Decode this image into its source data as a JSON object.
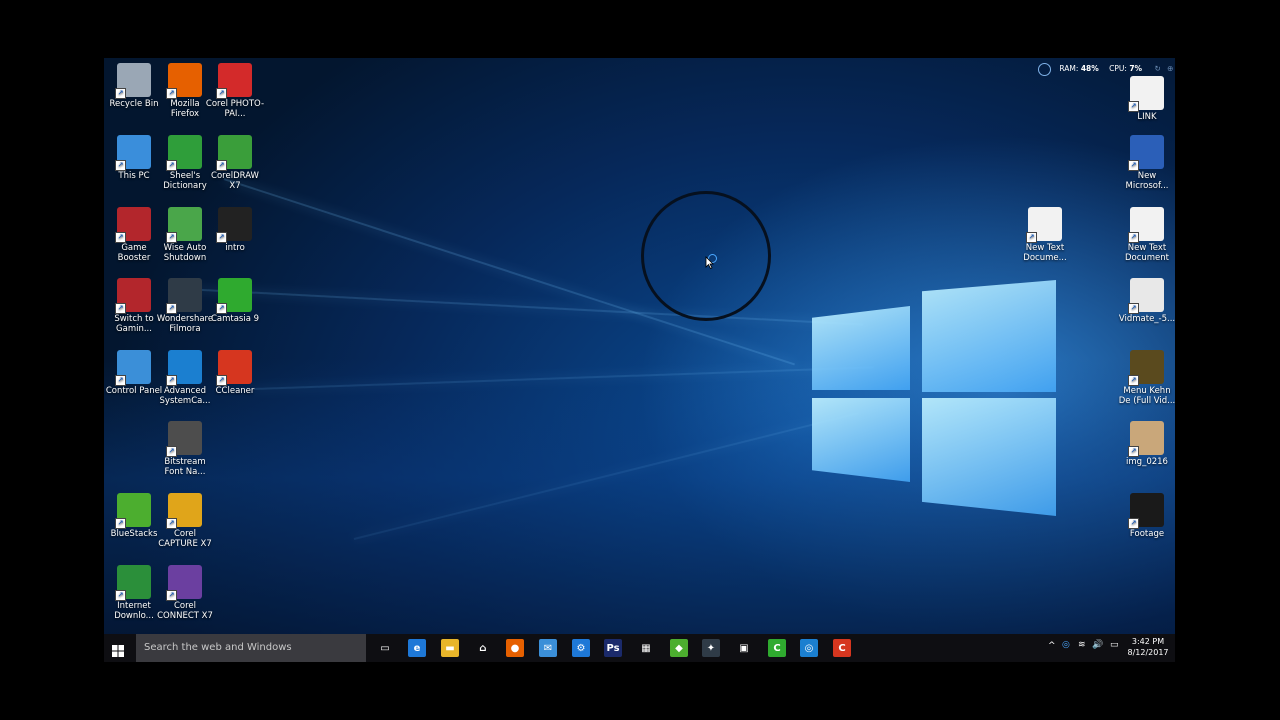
{
  "desktop": {
    "left_icons": [
      {
        "label": "Recycle Bin",
        "icon": "recycle-bin-icon",
        "color": "#9aa7b5"
      },
      {
        "label": "Mozilla Firefox",
        "icon": "firefox-icon",
        "color": "#e66000"
      },
      {
        "label": "Corel PHOTO-PAI...",
        "icon": "corel-photo-paint-icon",
        "color": "#d32a2a"
      },
      {
        "label": "This PC",
        "icon": "this-pc-icon",
        "color": "#3a8edb"
      },
      {
        "label": "Sheel's Dictionary",
        "icon": "sheels-dictionary-icon",
        "color": "#2f9e3a"
      },
      {
        "label": "CorelDRAW X7",
        "icon": "coreldraw-icon",
        "color": "#3a9e3a"
      },
      {
        "label": "Game Booster",
        "icon": "game-booster-icon",
        "color": "#b3262c"
      },
      {
        "label": "Wise Auto Shutdown",
        "icon": "wise-auto-shutdown-icon",
        "color": "#4aa64a"
      },
      {
        "label": "intro",
        "icon": "video-file-icon",
        "color": "#222222"
      },
      {
        "label": "Switch to Gamin...",
        "icon": "game-mode-icon",
        "color": "#b3262c"
      },
      {
        "label": "Wondershare Filmora",
        "icon": "filmora-icon",
        "color": "#2f3b47"
      },
      {
        "label": "Camtasia 9",
        "icon": "camtasia-icon",
        "color": "#2faa2f"
      },
      {
        "label": "Control Panel",
        "icon": "control-panel-icon",
        "color": "#3b8fd8"
      },
      {
        "label": "Advanced SystemCa...",
        "icon": "advanced-systemcare-icon",
        "color": "#1b7fd0"
      },
      {
        "label": "CCleaner",
        "icon": "ccleaner-icon",
        "color": "#d6361f"
      },
      {
        "label": "Bitstream Font Na...",
        "icon": "bitstream-font-icon",
        "color": "#4d4d4d"
      },
      {
        "label": "BlueStacks",
        "icon": "bluestacks-icon",
        "color": "#4cae2f"
      },
      {
        "label": "Corel CAPTURE X7",
        "icon": "corel-capture-icon",
        "color": "#e0a51a"
      },
      {
        "label": "Internet Downlo...",
        "icon": "internet-download-manager-icon",
        "color": "#2b8f3a"
      },
      {
        "label": "Corel CONNECT X7",
        "icon": "corel-connect-icon",
        "color": "#6b3fa0"
      }
    ],
    "right_icons": [
      {
        "label": "LINK",
        "icon": "text-file-icon",
        "color": "#f2f2f2"
      },
      {
        "label": "New Microsof...",
        "icon": "word-document-icon",
        "color": "#2b5fb8"
      },
      {
        "label": "New Text Docume...",
        "icon": "text-file-icon",
        "color": "#f2f2f2"
      },
      {
        "label": "New Text Document",
        "icon": "text-file-icon",
        "color": "#f2f2f2"
      },
      {
        "label": "Vidmate_-5...",
        "icon": "video-file-icon",
        "color": "#e8e8e8"
      },
      {
        "label": "Menu Kehn De (Full Vid...",
        "icon": "video-file-icon",
        "color": "#5a4a1e"
      },
      {
        "label": "img_0216",
        "icon": "image-file-icon",
        "color": "#c9a77a"
      },
      {
        "label": "Footage",
        "icon": "video-file-icon",
        "color": "#1a1a1a"
      }
    ]
  },
  "system_meter": {
    "ram_label": "RAM:",
    "ram_value": "48%",
    "cpu_label": "CPU:",
    "cpu_value": "7%"
  },
  "taskbar": {
    "search_placeholder": "Search the web and Windows",
    "apps": [
      {
        "name": "task-view-icon",
        "glyph": "▭",
        "color": "#0e0e12"
      },
      {
        "name": "edge-icon",
        "glyph": "e",
        "color": "#1e78d7"
      },
      {
        "name": "file-explorer-icon",
        "glyph": "▬",
        "color": "#e8b52a"
      },
      {
        "name": "store-icon",
        "glyph": "⌂",
        "color": "#0e0e12"
      },
      {
        "name": "firefox-icon",
        "glyph": "●",
        "color": "#e66000"
      },
      {
        "name": "mail-icon",
        "glyph": "✉",
        "color": "#3b8fd8"
      },
      {
        "name": "settings-icon",
        "glyph": "⚙",
        "color": "#1e78d7"
      },
      {
        "name": "photoshop-icon",
        "glyph": "Ps",
        "color": "#1b2a6b"
      },
      {
        "name": "calculator-icon",
        "glyph": "▦",
        "color": "#0e0e12"
      },
      {
        "name": "bluestacks-icon",
        "glyph": "◆",
        "color": "#4cae2f"
      },
      {
        "name": "filmora-icon",
        "glyph": "✦",
        "color": "#2f3b47"
      },
      {
        "name": "video-editor-icon",
        "glyph": "▣",
        "color": "#0e0e12"
      },
      {
        "name": "camtasia-icon",
        "glyph": "C",
        "color": "#2faa2f"
      },
      {
        "name": "advanced-systemcare-icon",
        "glyph": "◎",
        "color": "#1b7fd0"
      },
      {
        "name": "camtasia-recorder-icon",
        "glyph": "C",
        "color": "#d6361f"
      }
    ],
    "tray": {
      "time": "3:42 PM",
      "date": "8/12/2017"
    }
  }
}
